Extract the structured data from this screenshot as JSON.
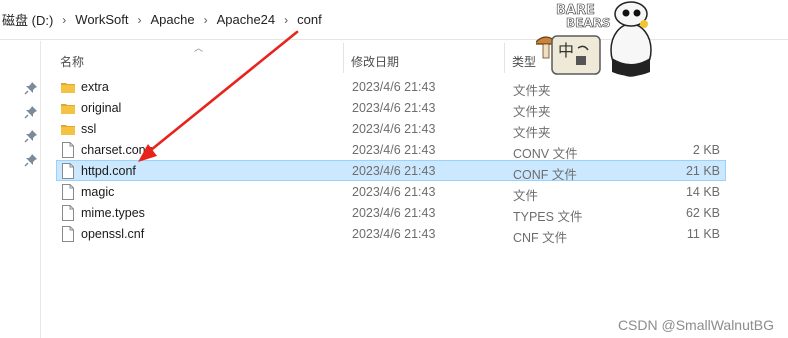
{
  "breadcrumb": [
    "磁盘 (D:)",
    "WorkSoft",
    "Apache",
    "Apache24",
    "conf"
  ],
  "columns": {
    "name": "名称",
    "date": "修改日期",
    "type": "类型"
  },
  "files": [
    {
      "name": "extra",
      "date": "2023/4/6 21:43",
      "type": "文件夹",
      "size": "",
      "kind": "folder"
    },
    {
      "name": "original",
      "date": "2023/4/6 21:43",
      "type": "文件夹",
      "size": "",
      "kind": "folder"
    },
    {
      "name": "ssl",
      "date": "2023/4/6 21:43",
      "type": "文件夹",
      "size": "",
      "kind": "folder"
    },
    {
      "name": "charset.conv",
      "date": "2023/4/6 21:43",
      "type": "CONV 文件",
      "size": "2 KB",
      "kind": "file"
    },
    {
      "name": "httpd.conf",
      "date": "2023/4/6 21:43",
      "type": "CONF 文件",
      "size": "21 KB",
      "kind": "file",
      "selected": true
    },
    {
      "name": "magic",
      "date": "2023/4/6 21:43",
      "type": "文件",
      "size": "14 KB",
      "kind": "file"
    },
    {
      "name": "mime.types",
      "date": "2023/4/6 21:43",
      "type": "TYPES 文件",
      "size": "62 KB",
      "kind": "file"
    },
    {
      "name": "openssl.cnf",
      "date": "2023/4/6 21:43",
      "type": "CNF 文件",
      "size": "11 KB",
      "kind": "file"
    }
  ],
  "sticker": {
    "text_line1": "BARE",
    "text_line2": "BEARS",
    "glyph": "中"
  },
  "watermark": "CSDN @SmallWalnutBG",
  "colors": {
    "selection": "#cce8ff",
    "selection_border": "#99d1ff",
    "folder": "#f5c342",
    "arrow": "#e8231c"
  },
  "icons": [
    "pin-icon",
    "folder-icon",
    "file-icon",
    "sort-up-icon"
  ]
}
